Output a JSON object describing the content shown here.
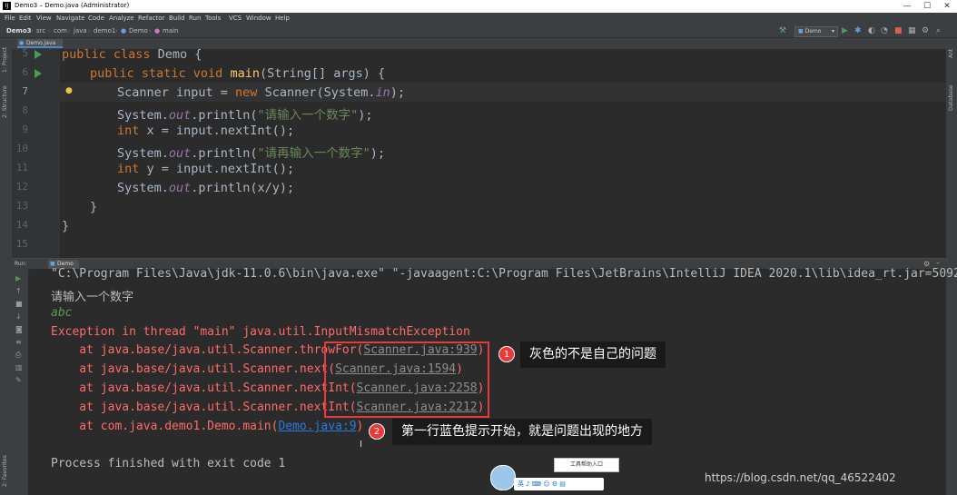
{
  "window": {
    "title": "Demo3 – Demo.java (Administrator)",
    "app_icon": "IJ",
    "minimize": "—",
    "maximize": "☐",
    "close": "✕"
  },
  "menu": [
    "File",
    "Edit",
    "View",
    "Navigate",
    "Code",
    "Analyze",
    "Refactor",
    "Build",
    "Run",
    "Tools",
    "VCS",
    "Window",
    "Help"
  ],
  "breadcrumbs": [
    "Demo3",
    "src",
    "com",
    "java",
    "demo1",
    "Demo",
    "main"
  ],
  "run_config": "Demo",
  "editor_tab": "Demo.java",
  "left_strip": {
    "project": "1: Project",
    "structure": "2: Structure",
    "favorites": "2: Favorites"
  },
  "right_strip": {
    "ant": "Ant",
    "database": "Database"
  },
  "line_numbers": [
    "5",
    "6",
    "7",
    "8",
    "9",
    "10",
    "11",
    "12",
    "13",
    "14",
    "15"
  ],
  "code": {
    "l5": {
      "kw": "public class ",
      "name": "Demo {"
    },
    "l6": {
      "kw1": "public static void ",
      "fn": "main",
      "rest": "(String[] args) {"
    },
    "l7": {
      "a": "Scanner input = ",
      "kw": "new ",
      "b": "Scanner(System.",
      "it": "in",
      "c": ");"
    },
    "l8": {
      "a": "System.",
      "it": "out",
      "b": ".println(",
      "str": "\"请输入一个数字\"",
      "c": ");"
    },
    "l9": {
      "kw": "int ",
      "a": "x = input.nextInt();"
    },
    "l10": {
      "a": "System.",
      "it": "out",
      "b": ".println(",
      "str": "\"请再输入一个数字\"",
      "c": ");"
    },
    "l11": {
      "kw": "int ",
      "a": "y = input.nextInt();"
    },
    "l12": {
      "a": "System.",
      "it": "out",
      "b": ".println(x/y);"
    },
    "l13": "}",
    "l14": "}"
  },
  "run_panel": {
    "label": "Run:",
    "tab": "Demo"
  },
  "console": {
    "cmd": "\"C:\\Program Files\\Java\\jdk-11.0.6\\bin\\java.exe\" \"-javaagent:C:\\Program Files\\JetBrains\\IntelliJ IDEA 2020.1\\lib\\idea_rt.jar=50928",
    "prompt": "请输入一个数字",
    "input": "abc",
    "exception": "Exception in thread \"main\" java.util.InputMismatchException",
    "trace": [
      {
        "pre": "    at java.base/java.util.Scanner.throwFor(",
        "link": "Scanner.java:939",
        "post": ")"
      },
      {
        "pre": "    at java.base/java.util.Scanner.next(",
        "link": "Scanner.java:1594",
        "post": ")"
      },
      {
        "pre": "    at java.base/java.util.Scanner.nextInt(",
        "link": "Scanner.java:2258",
        "post": ")"
      },
      {
        "pre": "    at java.base/java.util.Scanner.nextInt(",
        "link": "Scanner.java:2212",
        "post": ")"
      },
      {
        "pre": "    at com.java.demo1.Demo.main(",
        "link": "Demo.java:9",
        "post": ")"
      }
    ],
    "finished": "Process finished with exit code 1"
  },
  "annotations": [
    {
      "num": "1",
      "text": "灰色的不是自己的问题"
    },
    {
      "num": "2",
      "text": "第一行蓝色提示开始，就是问题出现的地方"
    }
  ],
  "ime": {
    "tip": "工具帮助入口",
    "bar": "英 ♪ ⌨ ☺ ⚙ ▤"
  },
  "watermark": "https://blog.csdn.net/qq_46522402",
  "colors": {
    "annotation_red": "#e83a3a",
    "callout_bg": "#1a1a1a",
    "error": "#ff6b68",
    "link": "#287bde"
  }
}
